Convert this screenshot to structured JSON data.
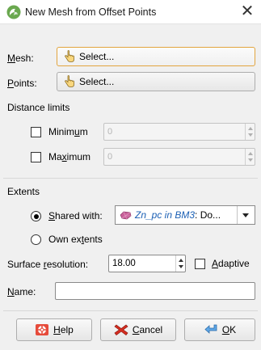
{
  "window": {
    "title": "New Mesh from Offset Points",
    "close_glyph": "✕",
    "icon": "leapfrog-app-icon"
  },
  "mesh": {
    "label_u": "M",
    "label_rest": "esh:",
    "button_label": "Select...",
    "icon": "hand-pointer-icon"
  },
  "points": {
    "label_u": "P",
    "label_rest": "oints:",
    "button_label": "Select...",
    "icon": "hand-pointer-icon"
  },
  "distance_limits": {
    "heading": "Distance limits",
    "minimum": {
      "label_a": "Minim",
      "label_u": "u",
      "label_b": "m",
      "checked": false,
      "value": "0"
    },
    "maximum": {
      "label_a": "Ma",
      "label_u": "x",
      "label_b": "imum",
      "checked": false,
      "value": "0"
    }
  },
  "extents": {
    "heading": "Extents",
    "shared": {
      "label_u": "S",
      "label_rest": "hared with:",
      "selected": true
    },
    "combo": {
      "object": "Zn_pc in BM3",
      "rest": ": Do...",
      "icon": "mesh-shape-icon",
      "color": "#c8609a"
    },
    "own": {
      "label_a": "Own ex",
      "label_u": "t",
      "label_b": "ents",
      "selected": false
    }
  },
  "surface": {
    "label_a": "Surface ",
    "label_u": "r",
    "label_b": "esolution:",
    "value": "18.00",
    "adaptive": {
      "label_u": "A",
      "label_rest": "daptive",
      "checked": false
    }
  },
  "name": {
    "label_u": "N",
    "label_rest": "ame:",
    "value": ""
  },
  "buttons": {
    "help": {
      "label_u": "H",
      "label_rest": "elp",
      "icon": "help-lifebuoy-icon"
    },
    "cancel": {
      "label_u": "C",
      "label_rest": "ancel",
      "icon": "cancel-x-icon"
    },
    "ok": {
      "label_u": "O",
      "label_rest": "K",
      "icon": "ok-arrow-icon"
    }
  },
  "colors": {
    "accent_border": "#e2a53f",
    "link_blue": "#1a5fb4"
  }
}
